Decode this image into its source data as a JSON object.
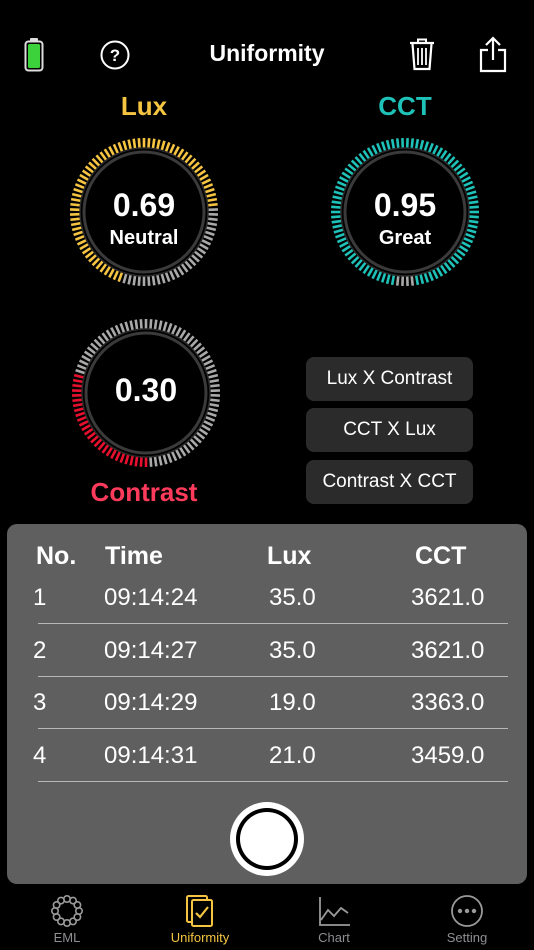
{
  "header": {
    "title": "Uniformity",
    "battery_color": "#3bd23b"
  },
  "gauges": {
    "lux": {
      "label": "Lux",
      "value": "0.69",
      "rating": "Neutral",
      "color": "#f5c542",
      "level": 0.69
    },
    "cct": {
      "label": "CCT",
      "value": "0.95",
      "rating": "Great",
      "color": "#1fc2b8",
      "level": 0.95
    },
    "contrast": {
      "label": "Contrast",
      "value": "0.30",
      "rating": "",
      "color": "#e8102e",
      "label_color": "#ff3b5c",
      "level": 0.3
    }
  },
  "combos": [
    "Lux X Contrast",
    "CCT X Lux",
    "Contrast X CCT"
  ],
  "table": {
    "headers": [
      "No.",
      "Time",
      "Lux",
      "CCT"
    ],
    "rows": [
      [
        "1",
        "09:14:24",
        "35.0",
        "3621.0"
      ],
      [
        "2",
        "09:14:27",
        "35.0",
        "3621.0"
      ],
      [
        "3",
        "09:14:29",
        "19.0",
        "3363.0"
      ],
      [
        "4",
        "09:14:31",
        "21.0",
        "3459.0"
      ]
    ]
  },
  "tabs": [
    {
      "label": "EML",
      "icon": "eml-dots-icon",
      "active": false
    },
    {
      "label": "Uniformity",
      "icon": "checklist-icon",
      "active": true
    },
    {
      "label": "Chart",
      "icon": "line-chart-icon",
      "active": false
    },
    {
      "label": "Setting",
      "icon": "more-dots-icon",
      "active": false
    }
  ],
  "colors": {
    "accent": "#f5c542",
    "inactive": "#8e8e93",
    "panel": "#5f5f5f"
  }
}
